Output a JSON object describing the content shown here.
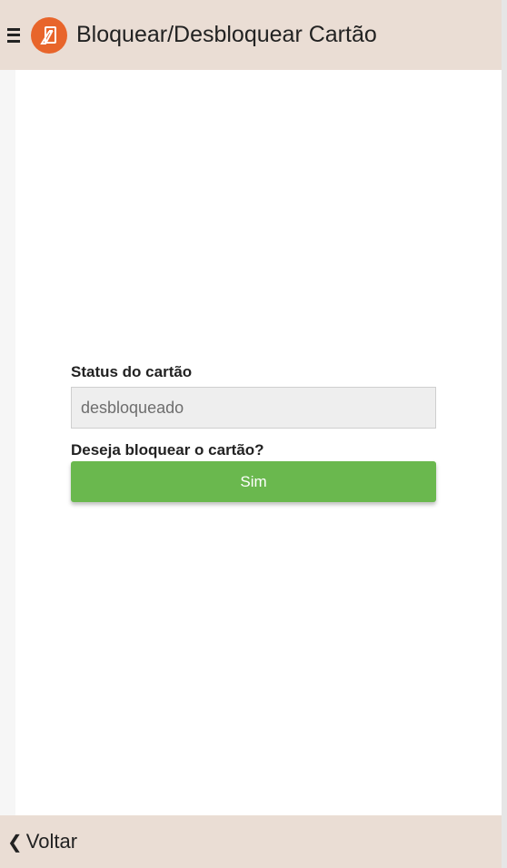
{
  "header": {
    "title": "Bloquear/Desbloquear Cartão",
    "menu_icon": "hamburger-menu-icon",
    "logo_icon": "card-logo-icon",
    "logo_color": "#e8652b",
    "background": "#eaddd4"
  },
  "form": {
    "status_label": "Status do cartão",
    "status_value": "desbloqueado",
    "question_label": "Deseja bloquear o cartão?",
    "confirm_button_label": "Sim",
    "confirm_button_color": "#6ab84e"
  },
  "footer": {
    "back_label": "Voltar",
    "back_icon": "chevron-left-icon"
  }
}
